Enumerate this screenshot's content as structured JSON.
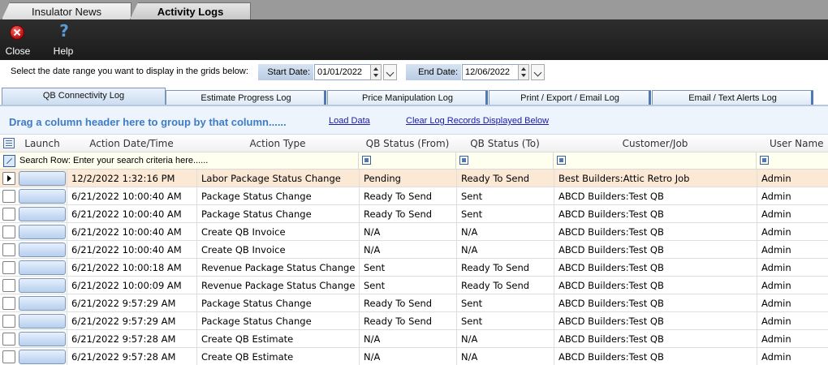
{
  "doc_tabs": [
    {
      "label": "Insulator News"
    },
    {
      "label": "Activity Logs"
    }
  ],
  "toolbar": {
    "close_label": "Close",
    "help_label": "Help"
  },
  "date_range": {
    "instruction": "Select the date range you want to display in the grids below:",
    "start_label": "Start Date:",
    "start_value": "01/01/2022",
    "end_label": "End Date:",
    "end_value": "12/06/2022"
  },
  "log_tabs": [
    {
      "label": "QB Connectivity Log",
      "active": true
    },
    {
      "label": "Estimate Progress Log"
    },
    {
      "label": "Price Manipulation Log"
    },
    {
      "label": "Print / Export / Email Log"
    },
    {
      "label": "Email / Text Alerts Log"
    }
  ],
  "group_bar": {
    "hint": "Drag a column header here to group by that column......",
    "load_data": "Load Data",
    "clear": "Clear Log Records Displayed Below"
  },
  "grid": {
    "columns": [
      "Launch",
      "Action Date/Time",
      "Action Type",
      "QB Status (From)",
      "QB Status (To)",
      "Customer/Job",
      "User Name"
    ],
    "search_row": "Search Row: Enter your search criteria here......",
    "rows": [
      {
        "date": "12/2/2022 1:32:16 PM",
        "type": "Labor Package Status Change",
        "from": "Pending",
        "to": "Ready To Send",
        "customer": "Best Builders:Attic Retro Job",
        "user": "Admin",
        "selected": true
      },
      {
        "date": "6/21/2022 10:00:40 AM",
        "type": "Package Status Change",
        "from": "Ready To Send",
        "to": "Sent",
        "customer": "ABCD Builders:Test QB",
        "user": "Admin"
      },
      {
        "date": "6/21/2022 10:00:40 AM",
        "type": "Package Status Change",
        "from": "Ready To Send",
        "to": "Sent",
        "customer": "ABCD Builders:Test QB",
        "user": "Admin"
      },
      {
        "date": "6/21/2022 10:00:40 AM",
        "type": "Create QB Invoice",
        "from": "N/A",
        "to": "N/A",
        "customer": "ABCD Builders:Test QB",
        "user": "Admin"
      },
      {
        "date": "6/21/2022 10:00:40 AM",
        "type": "Create QB Invoice",
        "from": "N/A",
        "to": "N/A",
        "customer": "ABCD Builders:Test QB",
        "user": "Admin"
      },
      {
        "date": "6/21/2022 10:00:18 AM",
        "type": "Revenue Package Status Change",
        "from": "Sent",
        "to": "Ready To Send",
        "customer": "ABCD Builders:Test QB",
        "user": "Admin"
      },
      {
        "date": "6/21/2022 10:00:09 AM",
        "type": "Revenue Package Status Change",
        "from": "Sent",
        "to": "Ready To Send",
        "customer": "ABCD Builders:Test QB",
        "user": "Admin"
      },
      {
        "date": "6/21/2022 9:57:29 AM",
        "type": "Package Status Change",
        "from": "Ready To Send",
        "to": "Sent",
        "customer": "ABCD Builders:Test QB",
        "user": "Admin"
      },
      {
        "date": "6/21/2022 9:57:29 AM",
        "type": "Package Status Change",
        "from": "Ready To Send",
        "to": "Sent",
        "customer": "ABCD Builders:Test QB",
        "user": "Admin"
      },
      {
        "date": "6/21/2022 9:57:28 AM",
        "type": "Create QB Estimate",
        "from": "N/A",
        "to": "N/A",
        "customer": "ABCD Builders:Test QB",
        "user": "Admin"
      },
      {
        "date": "6/21/2022 9:57:28 AM",
        "type": "Create QB Estimate",
        "from": "N/A",
        "to": "N/A",
        "customer": "ABCD Builders:Test QB",
        "user": "Admin"
      }
    ]
  }
}
